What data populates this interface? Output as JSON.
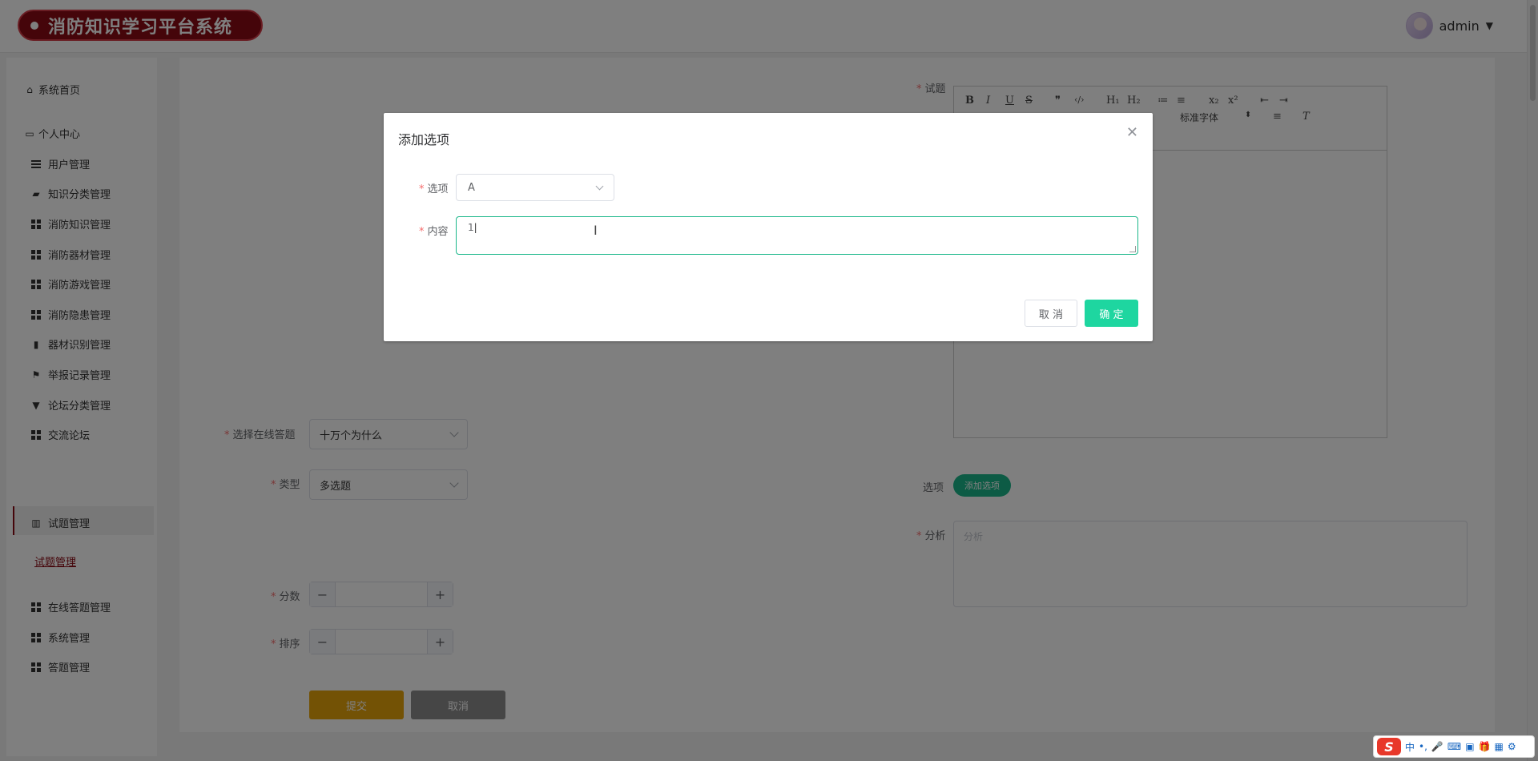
{
  "header": {
    "app_title": "消防知识学习平台系统",
    "username": "admin"
  },
  "sidebar": {
    "items": [
      {
        "label": "系统首页",
        "icon": "home-icon"
      },
      {
        "label": "个人中心",
        "icon": "profile-icon"
      },
      {
        "label": "用户管理",
        "icon": "list-icon"
      },
      {
        "label": "知识分类管理",
        "icon": "thumb-icon"
      },
      {
        "label": "消防知识管理",
        "icon": "grid-icon"
      },
      {
        "label": "消防器材管理",
        "icon": "grid-icon"
      },
      {
        "label": "消防游戏管理",
        "icon": "grid-icon"
      },
      {
        "label": "消防隐患管理",
        "icon": "grid-icon"
      },
      {
        "label": "器材识别管理",
        "icon": "barcode-icon"
      },
      {
        "label": "举报记录管理",
        "icon": "flag-icon"
      },
      {
        "label": "论坛分类管理",
        "icon": "cup-icon"
      },
      {
        "label": "交流论坛",
        "icon": "grid-icon"
      },
      {
        "label": "试题管理",
        "icon": "bar-chart-icon"
      },
      {
        "label": "在线答题管理",
        "icon": "grid-icon"
      },
      {
        "label": "系统管理",
        "icon": "grid-icon"
      },
      {
        "label": "答题管理",
        "icon": "grid-icon"
      }
    ],
    "sub_item": "试题管理"
  },
  "form": {
    "question_label": "试题",
    "select_exam_label": "选择在线答题",
    "select_exam_value": "十万个为什么",
    "type_label": "类型",
    "type_value": "多选题",
    "options_label": "选项",
    "add_option_button": "添加选项",
    "analysis_label": "分析",
    "analysis_placeholder": "分析",
    "score_label": "分数",
    "order_label": "排序",
    "submit_button": "提交",
    "cancel_button": "取消"
  },
  "editor": {
    "toolbar_row1": [
      "B",
      "I",
      "U",
      "S",
      "❞",
      "‹/›",
      "H₁",
      "H₂",
      "≔",
      "≡",
      "x₂",
      "x²",
      "⇤",
      "⇥"
    ],
    "font_label": "标准字体"
  },
  "dialog": {
    "title": "添加选项",
    "option_label": "选项",
    "option_value": "A",
    "content_label": "内容",
    "content_value": "1",
    "cancel_button": "取 消",
    "confirm_button": "确 定"
  },
  "ime": {
    "logo": "S",
    "lang": "中"
  },
  "colors": {
    "brand": "#8b0a14",
    "accent_green": "#1ed6a0",
    "submit_orange": "#e7a40b"
  }
}
